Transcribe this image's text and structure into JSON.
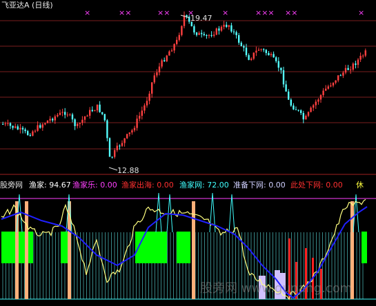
{
  "title": "飞亚达A (日线)",
  "price_chart": {
    "high_label": "19.47",
    "low_label": "12.88",
    "cross_markers": [
      "×",
      "××",
      "××",
      "×",
      "×",
      "×××",
      "××",
      "×"
    ]
  },
  "indicator": {
    "name": "股旁网",
    "fields": [
      {
        "label": "渔家: 94.67",
        "color": "#ffffff"
      },
      {
        "label": "渔家乐: 0.00",
        "color": "#ff40ff"
      },
      {
        "label": "渔家出海: 0.00",
        "color": "#ff3030"
      },
      {
        "label": "渔家网: 72.00",
        "color": "#40ffff"
      },
      {
        "label": "准备下网: 0.00",
        "color": "#d0d0ff"
      },
      {
        "label": "此处下网: 0.00",
        "color": "#ff3030"
      }
    ],
    "rest_label": "休"
  },
  "watermark": {
    "cn": "股旁网",
    "en": "www.gupang.com"
  },
  "colors": {
    "up": "#ff4040",
    "down": "#54ffff",
    "grid": "#7a1e1e",
    "magenta": "#ff40ff",
    "yellow_line": "#ffff80",
    "blue_line": "#2020ff",
    "green_block": "#00ff00",
    "orange_bar": "#ffb07a"
  }
}
